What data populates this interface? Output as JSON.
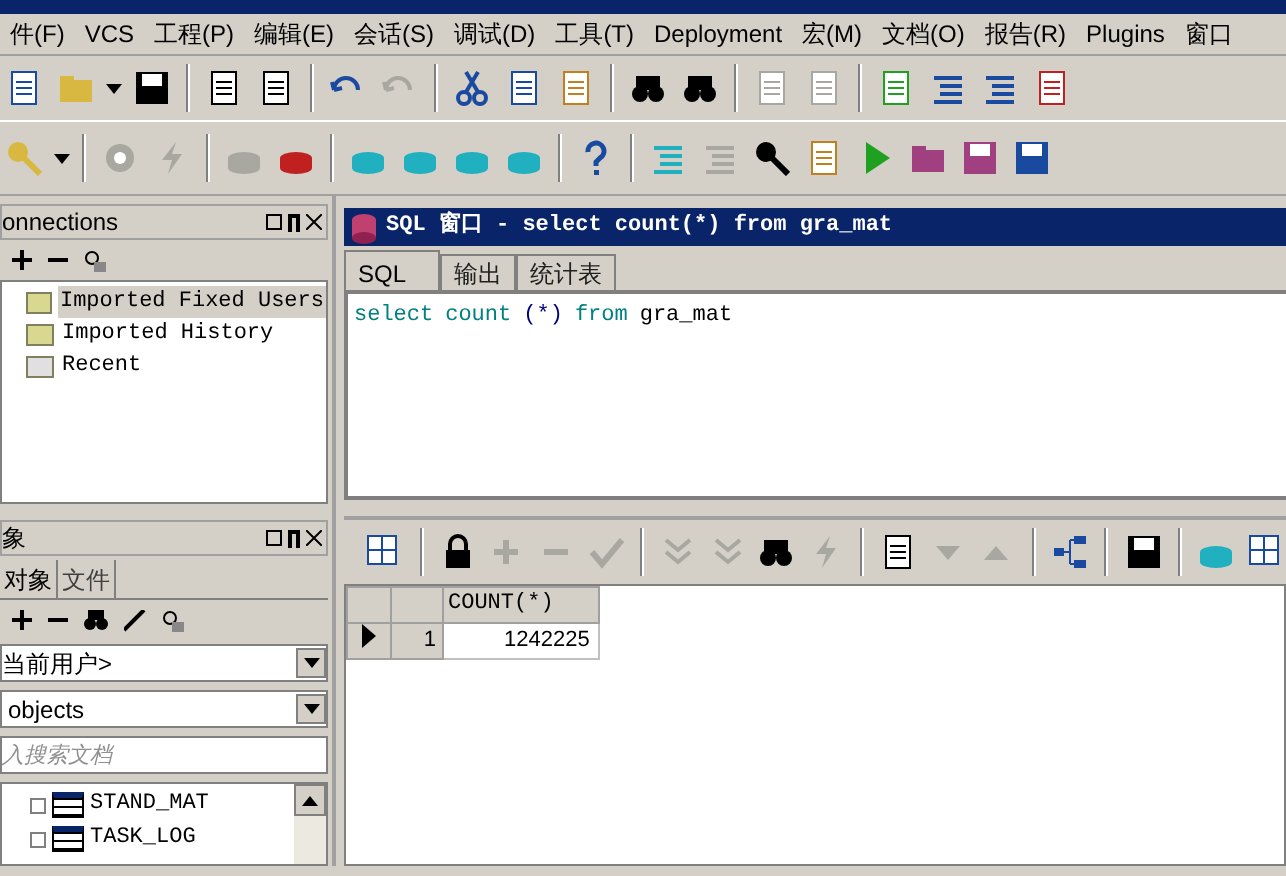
{
  "menu": [
    "件(F)",
    "VCS",
    "工程(P)",
    "编辑(E)",
    "会话(S)",
    "调试(D)",
    "工具(T)",
    "Deployment",
    "宏(M)",
    "文档(O)",
    "报告(R)",
    "Plugins",
    "窗口"
  ],
  "toolbar_1": [
    {
      "disabled": false
    },
    {
      "disabled": false
    },
    {
      "disabled": false
    },
    {
      "disabled": false
    },
    {
      "disabled": false
    },
    {
      "disabled": false
    },
    {
      "disabled": false
    },
    {
      "disabled": true
    },
    {
      "disabled": false
    },
    {
      "disabled": false
    },
    {
      "disabled": false
    },
    {
      "disabled": false
    },
    {
      "disabled": false
    },
    {
      "disabled": true
    },
    {
      "disabled": true
    },
    {
      "disabled": false
    },
    {
      "disabled": false
    },
    {
      "disabled": false
    },
    {
      "disabled": false
    }
  ],
  "toolbar_2": [
    {
      "disabled": false
    },
    {
      "disabled": false
    },
    {
      "disabled": true
    },
    {
      "disabled": true
    },
    {
      "disabled": true
    },
    {
      "disabled": false
    },
    {
      "disabled": false
    },
    {
      "disabled": false
    },
    {
      "disabled": false
    },
    {
      "disabled": false
    },
    {
      "disabled": false
    },
    {
      "disabled": false
    },
    {
      "disabled": true
    },
    {
      "disabled": false
    },
    {
      "disabled": false
    },
    {
      "disabled": false
    },
    {
      "disabled": false
    },
    {
      "disabled": false
    },
    {
      "disabled": false
    }
  ],
  "connections": {
    "title": "onnections",
    "items": [
      {
        "label": "Imported Fixed Users",
        "selected": true
      },
      {
        "label": "Imported History",
        "selected": false
      },
      {
        "label": "Recent",
        "selected": false
      }
    ]
  },
  "objects": {
    "title": "象",
    "tabs": [
      {
        "label": "对象",
        "selected": true
      },
      {
        "label": "文件",
        "selected": false
      }
    ],
    "user_select": "当前用户>",
    "type_select": "objects",
    "search": {
      "placeholder": "入搜索文档"
    },
    "items": [
      {
        "label": "STAND_MAT"
      },
      {
        "label": "TASK_LOG"
      }
    ]
  },
  "sql_window": {
    "title": "SQL 窗口 - select count(*) from gra_mat",
    "tabs": [
      {
        "label": "SQL",
        "selected": true
      },
      {
        "label": "输出",
        "selected": false
      },
      {
        "label": "统计表",
        "selected": false
      }
    ],
    "code": [
      {
        "text": "select",
        "kind": "keyword"
      },
      {
        "text": "count",
        "kind": "keyword"
      },
      {
        "text": "(*)",
        "kind": "symbol"
      },
      {
        "text": "from",
        "kind": "keyword"
      },
      {
        "text": "gra_mat",
        "kind": "name"
      }
    ],
    "grid_toolbar": [
      {
        "disabled": false
      },
      {
        "disabled": false
      },
      {
        "disabled": true
      },
      {
        "disabled": true
      },
      {
        "disabled": true
      },
      {
        "disabled": true
      },
      {
        "disabled": true
      },
      {
        "disabled": false
      },
      {
        "disabled": true
      },
      {
        "disabled": false
      },
      {
        "disabled": true
      },
      {
        "disabled": true
      },
      {
        "disabled": false
      },
      {
        "disabled": false
      },
      {
        "disabled": false
      },
      {
        "disabled": false
      }
    ],
    "table": {
      "columns": [
        "COUNT(*)"
      ],
      "rows": [
        {
          "number": "1",
          "current": true,
          "cells": [
            "1242225"
          ]
        }
      ]
    }
  }
}
